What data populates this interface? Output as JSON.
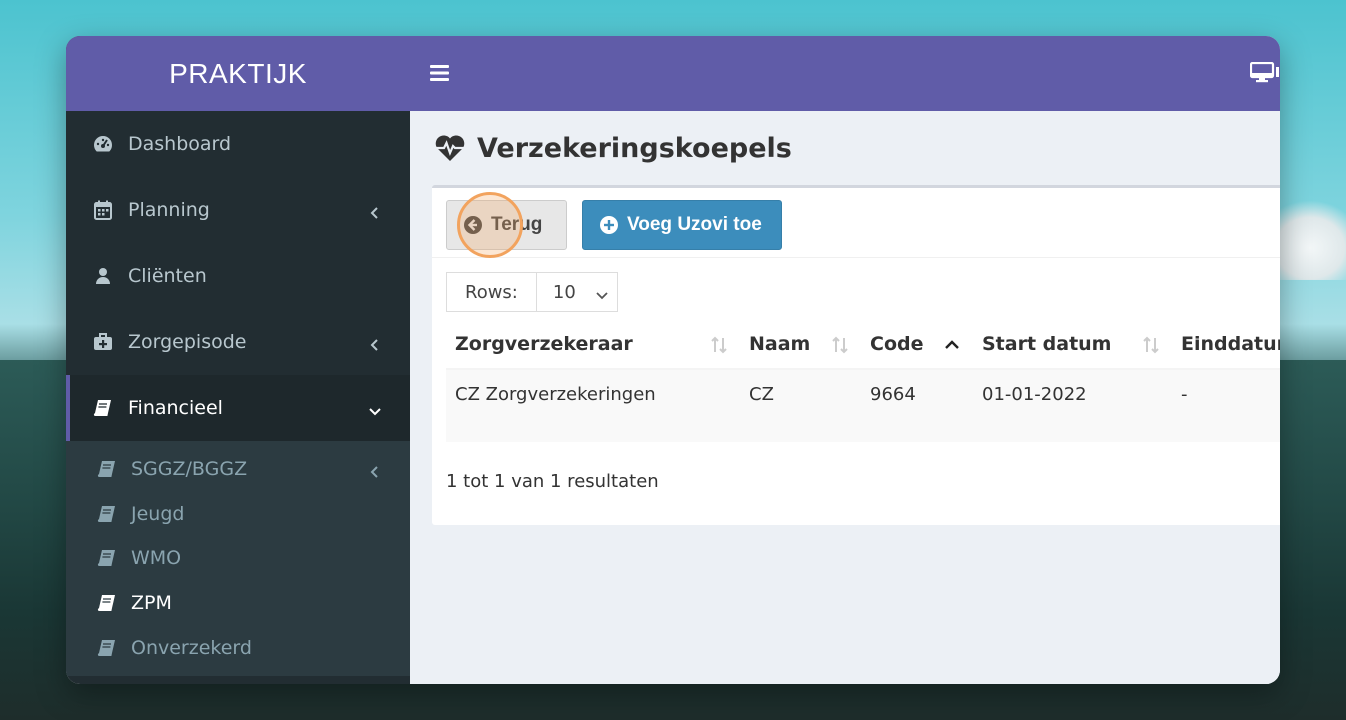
{
  "sidebar": {
    "brand": "PRAKTIJK",
    "items": [
      {
        "label": "Dashboard",
        "icon": "dashboard-icon"
      },
      {
        "label": "Planning",
        "icon": "calendar-icon"
      },
      {
        "label": "Cliënten",
        "icon": "user-icon"
      },
      {
        "label": "Zorgepisode",
        "icon": "medkit-icon"
      },
      {
        "label": "Financieel",
        "icon": "book-icon"
      }
    ],
    "submenu": [
      {
        "label": "SGGZ/BGGZ"
      },
      {
        "label": "Jeugd"
      },
      {
        "label": "WMO"
      },
      {
        "label": "ZPM"
      },
      {
        "label": "Onverzekerd"
      }
    ]
  },
  "page": {
    "title": "Verzekeringskoepels",
    "back_label": "Terug",
    "add_label": "Voeg Uzovi toe",
    "rows_label": "Rows:",
    "rows_value": "10",
    "result_info": "1 tot 1 van 1 resultaten"
  },
  "table": {
    "headers": [
      "Zorgverzekeraar",
      "Naam",
      "Code",
      "Start datum",
      "Einddatum"
    ],
    "rows": [
      [
        "CZ Zorgverzekeringen",
        "CZ",
        "9664",
        "01-01-2022",
        "-"
      ]
    ]
  },
  "colors": {
    "accent": "#605ca8",
    "sidebar_bg": "#222d32",
    "primary_button": "#3c8dbc"
  }
}
